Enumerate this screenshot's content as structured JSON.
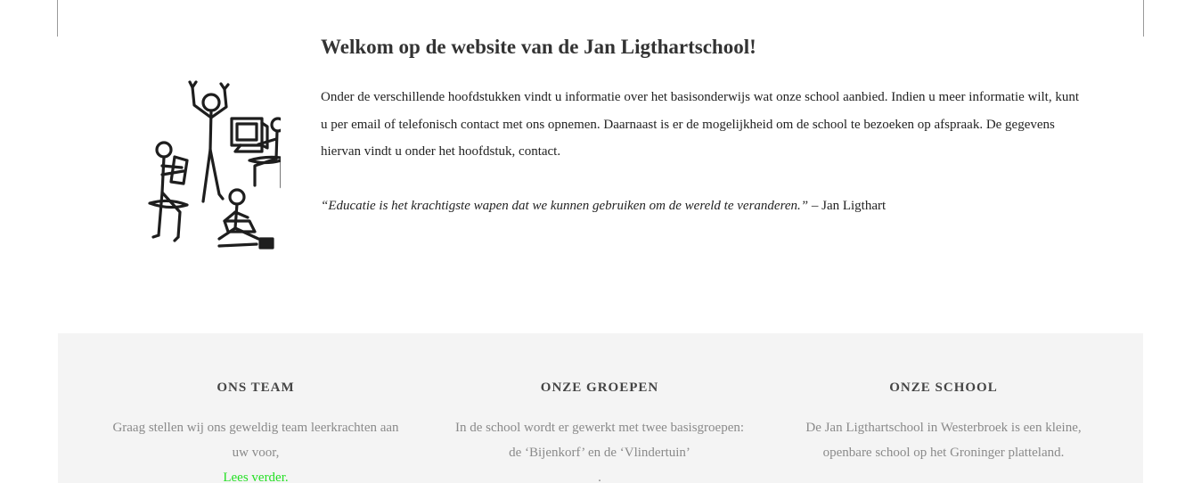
{
  "intro": {
    "title": "Welkom op de website van de Jan Ligthartschool!",
    "body": "Onder de verschillende hoofdstukken vindt u informatie over het basisonderwijs wat onze school aanbied. Indien u meer informatie wilt, kunt u per email of telefonisch contact met ons opnemen. Daarnaast is er de mogelijkheid om de school te bezoeken op afspraak. De gegevens hiervan vindt u onder het hoofdstuk, contact.",
    "quote": "“Educatie is het krachtigste wapen dat we kunnen gebruiken om de wereld te veranderen.”",
    "quote_author": " – Jan Ligthart"
  },
  "footer": {
    "team": {
      "heading": "ONS TEAM",
      "text": "Graag stellen  wij ons geweldig team leerkrachten aan uw voor,",
      "link": "Lees verder."
    },
    "groups": {
      "heading": "ONZE GROEPEN",
      "text": "In de school wordt er gewerkt met twee basisgroepen: de ‘Bijenkorf’ en de ‘Vlindertuin’",
      "more": "."
    },
    "school": {
      "heading": "ONZE SCHOOL",
      "text": "De Jan Ligthartschool in Westerbroek is een kleine, openbare school op het Groninger platteland."
    }
  },
  "colors": {
    "link": "#25e025",
    "band": "#f4f4f4",
    "muted_text": "#8a8a8a"
  }
}
